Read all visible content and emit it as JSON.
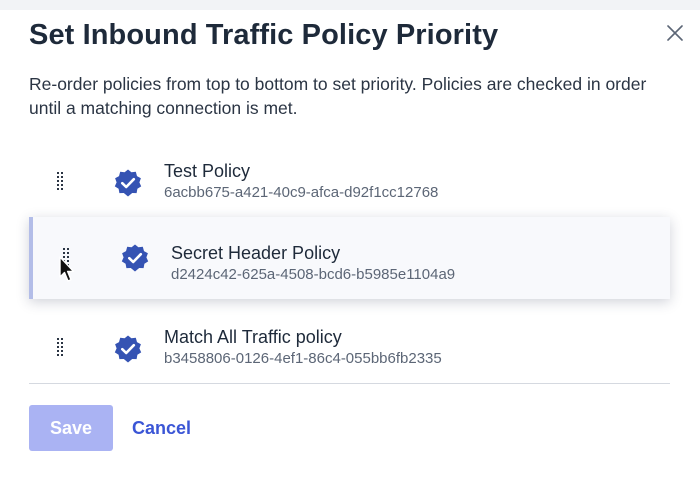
{
  "dialog": {
    "title": "Set Inbound Traffic Policy Priority",
    "description": "Re-order policies from top to bottom to set priority. Policies are checked in order until a matching connection is met.",
    "close_icon": "close-icon"
  },
  "policies": [
    {
      "name": "Test Policy",
      "id": "6acbb675-a421-40c9-afca-d92f1cc12768",
      "icon": "verified-badge-icon",
      "state": "default"
    },
    {
      "name": "Secret Header Policy",
      "id": "d2424c42-625a-4508-bcd6-b5985e1104a9",
      "icon": "verified-badge-icon",
      "state": "dragging"
    },
    {
      "name": "Match All Traffic policy",
      "id": "b3458806-0126-4ef1-86c4-055bb6fb2335",
      "icon": "verified-badge-icon",
      "state": "default"
    }
  ],
  "footer": {
    "save_label": "Save",
    "cancel_label": "Cancel"
  },
  "colors": {
    "title": "#1e2a3a",
    "badge": "#3553b3",
    "save_disabled": "#aab3f3",
    "link": "#3b56d6",
    "drag_accent": "#b3bde8"
  }
}
